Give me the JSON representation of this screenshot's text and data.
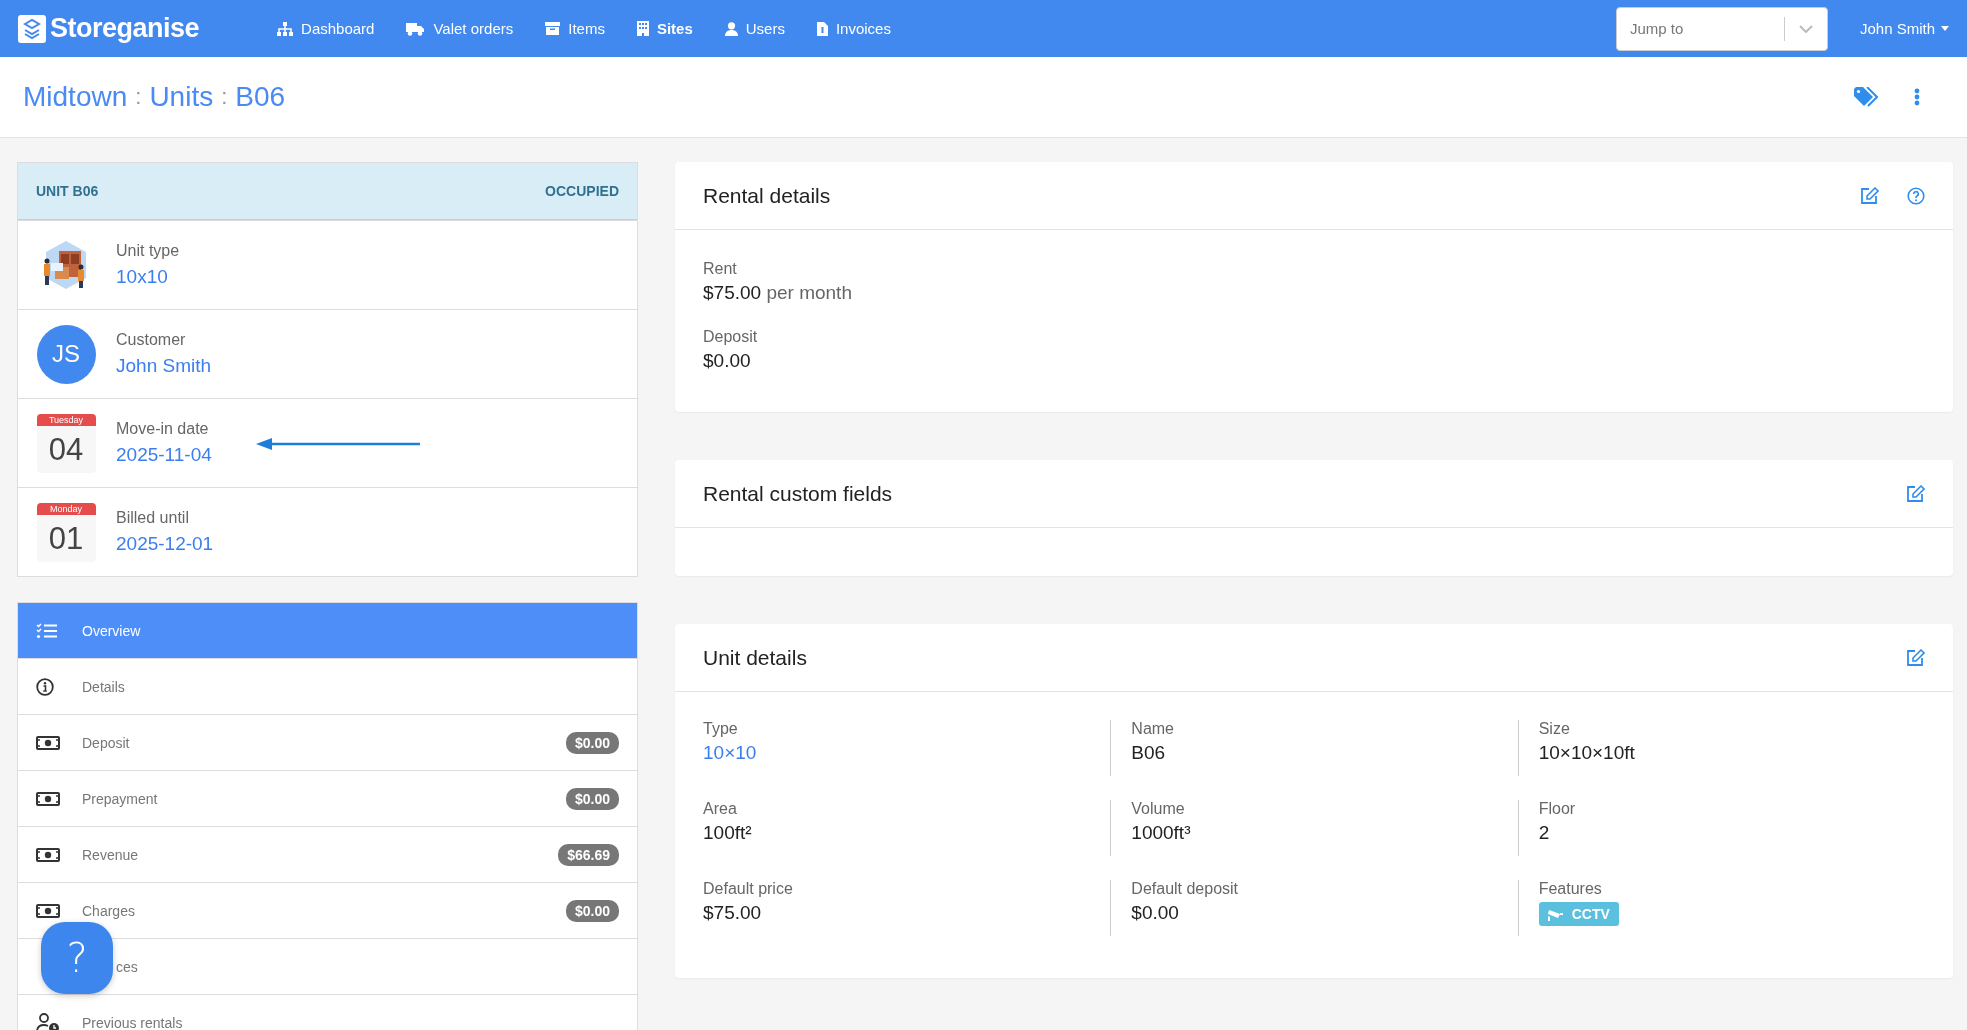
{
  "navbar": {
    "logo": "Storeganise",
    "items": [
      {
        "label": "Dashboard",
        "selected": false
      },
      {
        "label": "Valet orders",
        "selected": false
      },
      {
        "label": "Items",
        "selected": false
      },
      {
        "label": "Sites",
        "selected": true
      },
      {
        "label": "Users",
        "selected": false
      },
      {
        "label": "Invoices",
        "selected": false
      }
    ],
    "jump_to": {
      "placeholder": "Jump to"
    },
    "user": "John Smith"
  },
  "breadcrumb": {
    "separator": ":",
    "parts": [
      "Midtown",
      "Units",
      "B06"
    ]
  },
  "unit_panel": {
    "title": "UNIT B06",
    "status": "OCCUPIED",
    "rows": [
      {
        "kind": "image",
        "label": "Unit type",
        "value": "10x10"
      },
      {
        "kind": "avatar",
        "initials": "JS",
        "label": "Customer",
        "value": "John Smith"
      },
      {
        "kind": "calendar",
        "weekday": "Tuesday",
        "day": "04",
        "label": "Move-in date",
        "value": "2025-11-04",
        "annotated": true
      },
      {
        "kind": "calendar",
        "weekday": "Monday",
        "day": "01",
        "label": "Billed until",
        "value": "2025-12-01",
        "annotated": false
      }
    ]
  },
  "menu": [
    {
      "kind": "checklist",
      "label": "Overview",
      "selected": true
    },
    {
      "kind": "info",
      "label": "Details",
      "selected": false
    },
    {
      "kind": "money",
      "label": "Deposit",
      "selected": false,
      "badge": "$0.00"
    },
    {
      "kind": "money",
      "label": "Prepayment",
      "selected": false,
      "badge": "$0.00"
    },
    {
      "kind": "money",
      "label": "Revenue",
      "selected": false,
      "badge": "$66.69"
    },
    {
      "kind": "money",
      "label": "Charges",
      "selected": false,
      "badge": "$0.00"
    },
    {
      "kind": "covered",
      "label": "ces",
      "selected": false
    },
    {
      "kind": "history",
      "label": "Previous rentals",
      "selected": false
    }
  ],
  "help_button": {
    "label": "?"
  },
  "rental_details": {
    "title": "Rental details",
    "fields": [
      {
        "label": "Rent",
        "value": "$75.00",
        "suffix": "per month"
      },
      {
        "label": "Deposit",
        "value": "$0.00"
      }
    ]
  },
  "rental_custom_fields": {
    "title": "Rental custom fields"
  },
  "unit_details": {
    "title": "Unit details",
    "fields": [
      {
        "label": "Type",
        "value": "10×10",
        "link": true
      },
      {
        "label": "Name",
        "value": "B06",
        "link": false
      },
      {
        "label": "Size",
        "value": "10×10×10ft",
        "link": false
      },
      {
        "label": "Area",
        "value": "100ft²",
        "link": false
      },
      {
        "label": "Volume",
        "value": "1000ft³",
        "link": false
      },
      {
        "label": "Floor",
        "value": "2",
        "link": false
      },
      {
        "label": "Default price",
        "value": "$75.00",
        "link": false
      },
      {
        "label": "Default deposit",
        "value": "$0.00",
        "link": false
      },
      {
        "label": "Features",
        "tags": [
          "CCTV"
        ]
      }
    ]
  }
}
